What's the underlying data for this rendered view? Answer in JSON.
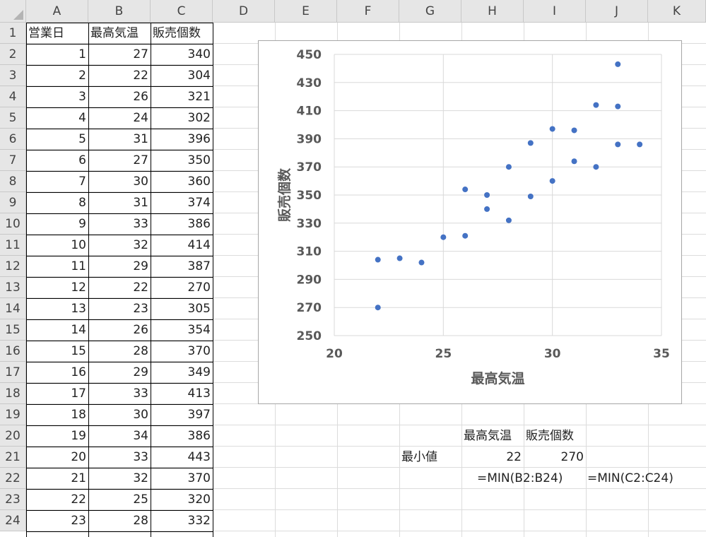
{
  "columns": [
    "A",
    "B",
    "C",
    "D",
    "E",
    "F",
    "G",
    "H",
    "I",
    "J",
    "K"
  ],
  "rows": [
    "1",
    "2",
    "3",
    "4",
    "5",
    "6",
    "7",
    "8",
    "9",
    "10",
    "11",
    "12",
    "13",
    "14",
    "15",
    "16",
    "17",
    "18",
    "19",
    "20",
    "21",
    "22",
    "23",
    "24"
  ],
  "table": {
    "headers": [
      "営業日",
      "最高気温",
      "販売個数"
    ],
    "data": [
      [
        "1",
        "27",
        "340"
      ],
      [
        "2",
        "22",
        "304"
      ],
      [
        "3",
        "26",
        "321"
      ],
      [
        "4",
        "24",
        "302"
      ],
      [
        "5",
        "31",
        "396"
      ],
      [
        "6",
        "27",
        "350"
      ],
      [
        "7",
        "30",
        "360"
      ],
      [
        "8",
        "31",
        "374"
      ],
      [
        "9",
        "33",
        "386"
      ],
      [
        "10",
        "32",
        "414"
      ],
      [
        "11",
        "29",
        "387"
      ],
      [
        "12",
        "22",
        "270"
      ],
      [
        "13",
        "23",
        "305"
      ],
      [
        "14",
        "26",
        "354"
      ],
      [
        "15",
        "28",
        "370"
      ],
      [
        "16",
        "29",
        "349"
      ],
      [
        "17",
        "33",
        "413"
      ],
      [
        "18",
        "30",
        "397"
      ],
      [
        "19",
        "34",
        "386"
      ],
      [
        "20",
        "33",
        "443"
      ],
      [
        "21",
        "32",
        "370"
      ],
      [
        "22",
        "25",
        "320"
      ],
      [
        "23",
        "28",
        "332"
      ]
    ]
  },
  "summary": {
    "header_b": "最高気温",
    "header_c": "販売個数",
    "min_label": "最小値",
    "min_b": "22",
    "min_c": "270",
    "formula_b": "=MIN(B2:B24)",
    "formula_c": "=MIN(C2:C24)"
  },
  "chart_data": {
    "type": "scatter",
    "title": "",
    "xlabel": "最高気温",
    "ylabel": "販売個数",
    "xlim": [
      20,
      35
    ],
    "ylim": [
      250,
      450
    ],
    "xticks": [
      "20",
      "25",
      "30",
      "35"
    ],
    "yticks": [
      "250",
      "270",
      "290",
      "310",
      "330",
      "350",
      "370",
      "390",
      "410",
      "430",
      "450"
    ],
    "grid": true,
    "marker_color": "#4472c4",
    "points": [
      [
        27,
        340
      ],
      [
        22,
        304
      ],
      [
        26,
        321
      ],
      [
        24,
        302
      ],
      [
        31,
        396
      ],
      [
        27,
        350
      ],
      [
        30,
        360
      ],
      [
        31,
        374
      ],
      [
        33,
        386
      ],
      [
        32,
        414
      ],
      [
        29,
        387
      ],
      [
        22,
        270
      ],
      [
        23,
        305
      ],
      [
        26,
        354
      ],
      [
        28,
        370
      ],
      [
        29,
        349
      ],
      [
        33,
        413
      ],
      [
        30,
        397
      ],
      [
        34,
        386
      ],
      [
        33,
        443
      ],
      [
        32,
        370
      ],
      [
        25,
        320
      ],
      [
        28,
        332
      ]
    ]
  }
}
